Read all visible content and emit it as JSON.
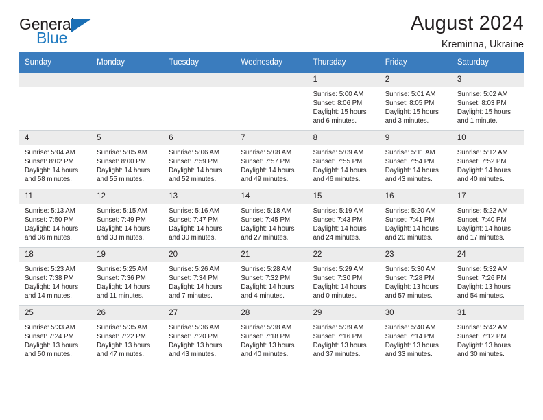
{
  "brand": {
    "name_part1": "General",
    "name_part2": "Blue",
    "flag_icon": "triangle-flag-icon"
  },
  "header": {
    "title": "August 2024",
    "subtitle": "Kreminna, Ukraine"
  },
  "calendar": {
    "accent_color": "#3a7cbe",
    "daynum_bg": "#ececec",
    "weekday_headers": [
      "Sunday",
      "Monday",
      "Tuesday",
      "Wednesday",
      "Thursday",
      "Friday",
      "Saturday"
    ],
    "labels": {
      "sunrise": "Sunrise:",
      "sunset": "Sunset:",
      "daylight": "Daylight:"
    },
    "weeks": [
      [
        {
          "day": "",
          "empty": true
        },
        {
          "day": "",
          "empty": true
        },
        {
          "day": "",
          "empty": true
        },
        {
          "day": "",
          "empty": true
        },
        {
          "day": "1",
          "sunrise": "Sunrise: 5:00 AM",
          "sunset": "Sunset: 8:06 PM",
          "daylight1": "Daylight: 15 hours",
          "daylight2": "and 6 minutes."
        },
        {
          "day": "2",
          "sunrise": "Sunrise: 5:01 AM",
          "sunset": "Sunset: 8:05 PM",
          "daylight1": "Daylight: 15 hours",
          "daylight2": "and 3 minutes."
        },
        {
          "day": "3",
          "sunrise": "Sunrise: 5:02 AM",
          "sunset": "Sunset: 8:03 PM",
          "daylight1": "Daylight: 15 hours",
          "daylight2": "and 1 minute."
        }
      ],
      [
        {
          "day": "4",
          "sunrise": "Sunrise: 5:04 AM",
          "sunset": "Sunset: 8:02 PM",
          "daylight1": "Daylight: 14 hours",
          "daylight2": "and 58 minutes."
        },
        {
          "day": "5",
          "sunrise": "Sunrise: 5:05 AM",
          "sunset": "Sunset: 8:00 PM",
          "daylight1": "Daylight: 14 hours",
          "daylight2": "and 55 minutes."
        },
        {
          "day": "6",
          "sunrise": "Sunrise: 5:06 AM",
          "sunset": "Sunset: 7:59 PM",
          "daylight1": "Daylight: 14 hours",
          "daylight2": "and 52 minutes."
        },
        {
          "day": "7",
          "sunrise": "Sunrise: 5:08 AM",
          "sunset": "Sunset: 7:57 PM",
          "daylight1": "Daylight: 14 hours",
          "daylight2": "and 49 minutes."
        },
        {
          "day": "8",
          "sunrise": "Sunrise: 5:09 AM",
          "sunset": "Sunset: 7:55 PM",
          "daylight1": "Daylight: 14 hours",
          "daylight2": "and 46 minutes."
        },
        {
          "day": "9",
          "sunrise": "Sunrise: 5:11 AM",
          "sunset": "Sunset: 7:54 PM",
          "daylight1": "Daylight: 14 hours",
          "daylight2": "and 43 minutes."
        },
        {
          "day": "10",
          "sunrise": "Sunrise: 5:12 AM",
          "sunset": "Sunset: 7:52 PM",
          "daylight1": "Daylight: 14 hours",
          "daylight2": "and 40 minutes."
        }
      ],
      [
        {
          "day": "11",
          "sunrise": "Sunrise: 5:13 AM",
          "sunset": "Sunset: 7:50 PM",
          "daylight1": "Daylight: 14 hours",
          "daylight2": "and 36 minutes."
        },
        {
          "day": "12",
          "sunrise": "Sunrise: 5:15 AM",
          "sunset": "Sunset: 7:49 PM",
          "daylight1": "Daylight: 14 hours",
          "daylight2": "and 33 minutes."
        },
        {
          "day": "13",
          "sunrise": "Sunrise: 5:16 AM",
          "sunset": "Sunset: 7:47 PM",
          "daylight1": "Daylight: 14 hours",
          "daylight2": "and 30 minutes."
        },
        {
          "day": "14",
          "sunrise": "Sunrise: 5:18 AM",
          "sunset": "Sunset: 7:45 PM",
          "daylight1": "Daylight: 14 hours",
          "daylight2": "and 27 minutes."
        },
        {
          "day": "15",
          "sunrise": "Sunrise: 5:19 AM",
          "sunset": "Sunset: 7:43 PM",
          "daylight1": "Daylight: 14 hours",
          "daylight2": "and 24 minutes."
        },
        {
          "day": "16",
          "sunrise": "Sunrise: 5:20 AM",
          "sunset": "Sunset: 7:41 PM",
          "daylight1": "Daylight: 14 hours",
          "daylight2": "and 20 minutes."
        },
        {
          "day": "17",
          "sunrise": "Sunrise: 5:22 AM",
          "sunset": "Sunset: 7:40 PM",
          "daylight1": "Daylight: 14 hours",
          "daylight2": "and 17 minutes."
        }
      ],
      [
        {
          "day": "18",
          "sunrise": "Sunrise: 5:23 AM",
          "sunset": "Sunset: 7:38 PM",
          "daylight1": "Daylight: 14 hours",
          "daylight2": "and 14 minutes."
        },
        {
          "day": "19",
          "sunrise": "Sunrise: 5:25 AM",
          "sunset": "Sunset: 7:36 PM",
          "daylight1": "Daylight: 14 hours",
          "daylight2": "and 11 minutes."
        },
        {
          "day": "20",
          "sunrise": "Sunrise: 5:26 AM",
          "sunset": "Sunset: 7:34 PM",
          "daylight1": "Daylight: 14 hours",
          "daylight2": "and 7 minutes."
        },
        {
          "day": "21",
          "sunrise": "Sunrise: 5:28 AM",
          "sunset": "Sunset: 7:32 PM",
          "daylight1": "Daylight: 14 hours",
          "daylight2": "and 4 minutes."
        },
        {
          "day": "22",
          "sunrise": "Sunrise: 5:29 AM",
          "sunset": "Sunset: 7:30 PM",
          "daylight1": "Daylight: 14 hours",
          "daylight2": "and 0 minutes."
        },
        {
          "day": "23",
          "sunrise": "Sunrise: 5:30 AM",
          "sunset": "Sunset: 7:28 PM",
          "daylight1": "Daylight: 13 hours",
          "daylight2": "and 57 minutes."
        },
        {
          "day": "24",
          "sunrise": "Sunrise: 5:32 AM",
          "sunset": "Sunset: 7:26 PM",
          "daylight1": "Daylight: 13 hours",
          "daylight2": "and 54 minutes."
        }
      ],
      [
        {
          "day": "25",
          "sunrise": "Sunrise: 5:33 AM",
          "sunset": "Sunset: 7:24 PM",
          "daylight1": "Daylight: 13 hours",
          "daylight2": "and 50 minutes."
        },
        {
          "day": "26",
          "sunrise": "Sunrise: 5:35 AM",
          "sunset": "Sunset: 7:22 PM",
          "daylight1": "Daylight: 13 hours",
          "daylight2": "and 47 minutes."
        },
        {
          "day": "27",
          "sunrise": "Sunrise: 5:36 AM",
          "sunset": "Sunset: 7:20 PM",
          "daylight1": "Daylight: 13 hours",
          "daylight2": "and 43 minutes."
        },
        {
          "day": "28",
          "sunrise": "Sunrise: 5:38 AM",
          "sunset": "Sunset: 7:18 PM",
          "daylight1": "Daylight: 13 hours",
          "daylight2": "and 40 minutes."
        },
        {
          "day": "29",
          "sunrise": "Sunrise: 5:39 AM",
          "sunset": "Sunset: 7:16 PM",
          "daylight1": "Daylight: 13 hours",
          "daylight2": "and 37 minutes."
        },
        {
          "day": "30",
          "sunrise": "Sunrise: 5:40 AM",
          "sunset": "Sunset: 7:14 PM",
          "daylight1": "Daylight: 13 hours",
          "daylight2": "and 33 minutes."
        },
        {
          "day": "31",
          "sunrise": "Sunrise: 5:42 AM",
          "sunset": "Sunset: 7:12 PM",
          "daylight1": "Daylight: 13 hours",
          "daylight2": "and 30 minutes."
        }
      ]
    ]
  }
}
